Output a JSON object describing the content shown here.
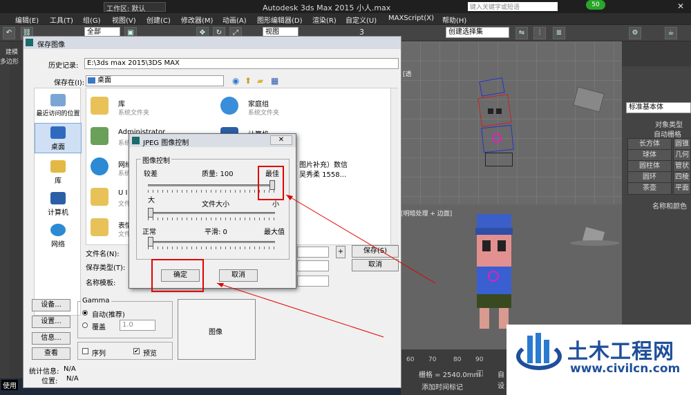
{
  "app": {
    "workspace_label": "工作区: 默认",
    "title": "Autodesk 3ds Max  2015     小人.max",
    "search_placeholder": "键入关键字或短语",
    "badge": "50"
  },
  "menu": [
    "编辑(E)",
    "工具(T)",
    "组(G)",
    "视图(V)",
    "创建(C)",
    "修改器(M)",
    "动画(A)",
    "图形编辑器(D)",
    "渲染(R)",
    "自定义(U)",
    "MAXScript(X)",
    "帮助(H)"
  ],
  "toolbar": {
    "filter": "全部",
    "view": "视图",
    "number": "3",
    "selection_set": "创建选择集"
  },
  "left_tabs": [
    "建模",
    "多边形"
  ],
  "viewport": {
    "bottom_label": "[明暗处理 + 边面]",
    "top_label": "[透"
  },
  "cmd_panel": {
    "category": "标准基本体",
    "object_type": "对象类型",
    "autogrid": "自动栅格",
    "buttons": [
      [
        "长方体",
        "圆锥"
      ],
      [
        "球体",
        "几何"
      ],
      [
        "圆柱体",
        "管状"
      ],
      [
        "圆环",
        "四棱"
      ],
      [
        "茶壶",
        "平面"
      ]
    ],
    "name_color": "名称和颜色"
  },
  "timeline": {
    "ticks": [
      "60",
      "70",
      "80",
      "90"
    ],
    "grid": "栅格 = 2540.0mm",
    "add_marker": "添加时间标记",
    "auto": "自",
    "set": "设"
  },
  "taskbar": {
    "tray": "使用"
  },
  "save_dialog": {
    "title": "保存图像",
    "history_label": "历史记录:",
    "history_value": "E:\\3ds max 2015\\3DS MAX",
    "savein_label": "保存在(I):",
    "savein_value": "桌面",
    "places": [
      "最近访问的位置",
      "桌面",
      "库",
      "计算机",
      "网络"
    ],
    "files": [
      {
        "name": "库",
        "sub": "系统文件夹"
      },
      {
        "name": "家庭组",
        "sub": "系统文件夹"
      },
      {
        "name": "Administrator",
        "sub": "系统"
      },
      {
        "name": "计算机",
        "sub": ""
      },
      {
        "name": "网络",
        "sub": "系统"
      },
      {
        "name": "图片补充）数信",
        "sub": "吴秀柔 1558..."
      },
      {
        "name": "U I",
        "sub": "文件"
      },
      {
        "name": "表情",
        "sub": "文件"
      }
    ],
    "filename_label": "文件名(N):",
    "filetype_label": "保存类型(T):",
    "template_label": "名称模板:",
    "plus": "+",
    "save_btn": "保存(S)",
    "cancel_btn": "取消",
    "setup_btn": "设备...",
    "settings_btn": "设置...",
    "info_btn": "信息...",
    "view_btn": "查看",
    "gamma_title": "Gamma",
    "gamma_auto": "自动(推荐)",
    "gamma_override": "覆盖",
    "gamma_value": "1.0",
    "sequence": "序列",
    "preview": "预览",
    "image_box": "图像",
    "stats_label": "统计信息:",
    "stats_value": "N/A",
    "location_label": "位置:",
    "location_value": "N/A"
  },
  "jpeg_dialog": {
    "title": "JPEG 图像控制",
    "group": "图像控制",
    "quality_low": "较差",
    "quality_label": "质量: 100",
    "quality_high": "最佳",
    "quality_value": 1.0,
    "size_big": "大",
    "size_label": "文件大小",
    "size_small": "小",
    "size_value": 0.0,
    "smooth_normal": "正常",
    "smooth_label": "平滑:  0",
    "smooth_max": "最大值",
    "smooth_value": 0.0,
    "ok": "确定",
    "cancel": "取消",
    "close": "✕"
  },
  "watermark": {
    "text": "土木工程网",
    "url": "www.civilcn.com"
  }
}
